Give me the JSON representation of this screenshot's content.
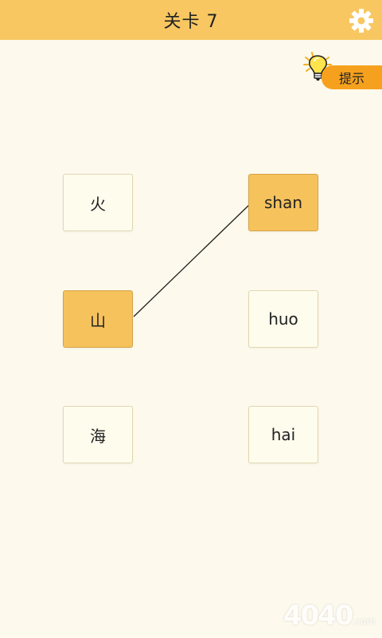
{
  "header": {
    "title": "关卡 7"
  },
  "hint": {
    "label": "提示"
  },
  "left_cards": [
    {
      "label": "火",
      "selected": false
    },
    {
      "label": "山",
      "selected": true
    },
    {
      "label": "海",
      "selected": false
    }
  ],
  "right_cards": [
    {
      "label": "shan",
      "selected": true
    },
    {
      "label": "huo",
      "selected": false
    },
    {
      "label": "hai",
      "selected": false
    }
  ],
  "watermark": {
    "text": "4040",
    "suffix": ".com"
  },
  "colors": {
    "header": "#f8c761",
    "background": "#fdf9ec",
    "selected_card": "#f6c25c",
    "hint_tab": "#f6a11e"
  }
}
